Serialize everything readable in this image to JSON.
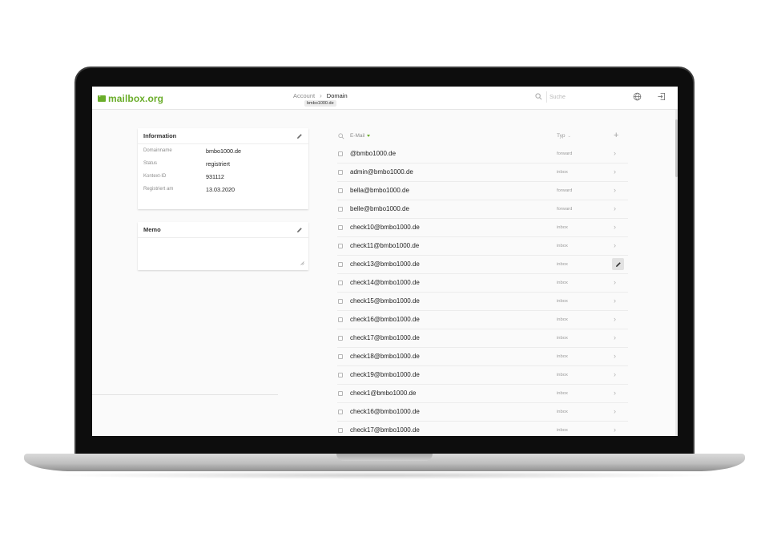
{
  "app": {
    "logo_text": "mailbox.org",
    "brand_color": "#6aad2a"
  },
  "breadcrumb": {
    "account": "Account",
    "separator": "›",
    "domain": "Domain",
    "chip": "bmbo1000.de"
  },
  "search": {
    "placeholder": "Suche",
    "icon": "search-icon"
  },
  "header_icons": [
    "globe-icon",
    "logout-icon"
  ],
  "information": {
    "title": "Information",
    "rows": [
      {
        "label": "Domainname",
        "value": "bmbo1000.de"
      },
      {
        "label": "Status",
        "value": "registriert"
      },
      {
        "label": "Kontext-ID",
        "value": "931112"
      },
      {
        "label": "Registriert am",
        "value": "13.03.2020"
      }
    ]
  },
  "memo": {
    "title": "Memo"
  },
  "list": {
    "email_header": "E-Mail",
    "type_header": "Typ",
    "add_label": "+",
    "rows": [
      {
        "email": "@bmbo1000.de",
        "type": "forward"
      },
      {
        "email": "admin@bmbo1000.de",
        "type": "inbox"
      },
      {
        "email": "bella@bmbo1000.de",
        "type": "forward"
      },
      {
        "email": "belle@bmbo1000.de",
        "type": "forward"
      },
      {
        "email": "check10@bmbo1000.de",
        "type": "inbox"
      },
      {
        "email": "check11@bmbo1000.de",
        "type": "inbox"
      },
      {
        "email": "check13@bmbo1000.de",
        "type": "inbox",
        "hover_edit": true
      },
      {
        "email": "check14@bmbo1000.de",
        "type": "inbox"
      },
      {
        "email": "check15@bmbo1000.de",
        "type": "inbox"
      },
      {
        "email": "check16@bmbo1000.de",
        "type": "inbox"
      },
      {
        "email": "check17@bmbo1000.de",
        "type": "inbox"
      },
      {
        "email": "check18@bmbo1000.de",
        "type": "inbox"
      },
      {
        "email": "check19@bmbo1000.de",
        "type": "inbox"
      },
      {
        "email": "check1@bmbo1000.de",
        "type": "inbox"
      },
      {
        "email": "check16@bmbo1000.de",
        "type": "inbox"
      },
      {
        "email": "check17@bmbo1000.de",
        "type": "inbox"
      }
    ]
  }
}
